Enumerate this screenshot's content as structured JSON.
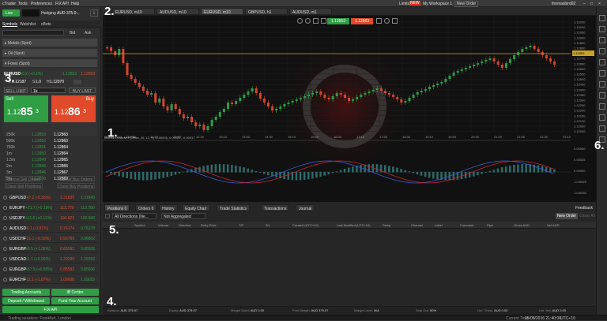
{
  "menu": {
    "app": "cTrader",
    "items": [
      "Tools",
      "Preferences",
      "FIX API",
      "Help"
    ],
    "limits": "Limits",
    "new_badge": "NEW",
    "workspace": "My Workspace 1",
    "new_order": "New Order",
    "user": "thomasbird92"
  },
  "account": {
    "live": "Live",
    "hedging": "Hedging",
    "balance": "AUD 375.0..."
  },
  "left_tabs": [
    "Symbols",
    "Watchlist",
    "cBots"
  ],
  "bidask": {
    "bid": "Bid",
    "ask": "Ask"
  },
  "groups": [
    "Metals (Spot)",
    "Oil (Spot)",
    "Forex (Spot)"
  ],
  "eurusd": {
    "symbol": "EURUSD",
    "change": "+0.2 (+0.1%)",
    "bid": "1.12853",
    "ask": "1.12863",
    "low_label": "L",
    "low": "1.12187",
    "spread_label": "S",
    "spread": "1.0",
    "high_label": "H",
    "high": "1.12970",
    "sell_limit": "SELL LIMIT",
    "buy_limit": "BUY LIMIT",
    "volume": "1k"
  },
  "trade": {
    "sell": "Sell",
    "buy": "Buy",
    "sell_main": "1.12",
    "sell_big": "85",
    "sell_pip": "3",
    "buy_main": "1.12",
    "buy_big": "86",
    "buy_pip": "3"
  },
  "ladder": [
    {
      "vol": "250k",
      "bid": "1.12853",
      "ask": "1.12863"
    },
    {
      "vol": "500k",
      "bid": "1.12852",
      "ask": "1.12863"
    },
    {
      "vol": "750k",
      "bid": "1.12851",
      "ask": "1.12864"
    },
    {
      "vol": "1m",
      "bid": "1.12850",
      "ask": "1.12864"
    },
    {
      "vol": "1.5m",
      "bid": "1.12849",
      "ask": "1.12865"
    },
    {
      "vol": "2m",
      "bid": "1.12848",
      "ask": "1.12866"
    },
    {
      "vol": "3m",
      "bid": "1.12846",
      "ask": "1.12867"
    },
    {
      "vol": "5m",
      "bid": "1.12843",
      "ask": "1.12869"
    }
  ],
  "ladder_buttons": [
    "Cancel Sell Orders",
    "Cancel Buy Orders",
    "Close Sell Positions",
    "Close Buy Positions"
  ],
  "watch": [
    {
      "sym": "GBPUSD",
      "chg": "-47.2 (-0.36%)",
      "bid": "1.31839",
      "ask": "1.31849"
    },
    {
      "sym": "EURJPY",
      "chg": "+21.7 (+0.19%)",
      "bid": "113.770",
      "ask": "113.780"
    },
    {
      "sym": "USDJPY",
      "chg": "+11.6 (+0.11%)",
      "bid": "100.823",
      "ask": "100.840"
    },
    {
      "sym": "AUDUSD",
      "chg": "-6.1 (-0.81%)",
      "bid": "0.76174",
      "ask": "0.76178"
    },
    {
      "sym": "USDCHF",
      "chg": "-31.1 (-0.32%)",
      "bid": "0.96789",
      "ask": "0.96802"
    },
    {
      "sym": "EURGBP",
      "chg": "+8.5 (+1.08%)",
      "bid": "0.85592",
      "ask": "0.85608"
    },
    {
      "sym": "USDCAD",
      "chg": "+1.1 (+0.09%)",
      "bid": "1.29339",
      "ask": "1.29352"
    },
    {
      "sym": "EURGBP",
      "chg": "+67.5 (+0.80%)",
      "bid": "0.85593",
      "ask": "0.85606"
    },
    {
      "sym": "EURCHF",
      "chg": "-11.1 (-1.07%)",
      "bid": "1.09008",
      "ask": "1.09025"
    }
  ],
  "footer_buttons": {
    "trading_accounts": "Trading Accounts",
    "ib_centre": "IB Centre",
    "deposit": "Deposit / Withdrawal",
    "fund": "Fund Your Account",
    "fix_api": "FIX API"
  },
  "chart_tabs": [
    "EURUSD, m10",
    "AUDUSD, m10",
    "EURUSD, m10",
    "GBPUSD, h1",
    "AUDUSD, m1"
  ],
  "chart_prices": {
    "sell": "1.12853",
    "buy": "1.12863",
    "last": "1.12853"
  },
  "y_ticks": [
    "1.12000",
    "1.12050",
    "1.12100",
    "1.12150",
    "1.12200",
    "1.12250",
    "1.12300",
    "1.12350",
    "1.12400",
    "1.12450",
    "1.12500",
    "1.12550",
    "1.12600",
    "1.12650",
    "1.12700",
    "1.12750",
    "1.12800",
    "1.12850",
    "1.12900",
    "1.12950",
    "1.13000",
    "1.13050"
  ],
  "x_ticks": [
    "25 Aug 2016, UTC+10",
    "10:30",
    "11:10",
    "11:50",
    "12:30",
    "13:10",
    "13:50",
    "14:30",
    "15:10",
    "15:50",
    "16:30",
    "17:10",
    "17:50",
    "18:30",
    "19:10",
    "19:50",
    "20:30",
    "21:10",
    "21:50",
    "22:30",
    "23:10"
  ],
  "macd_title": "MACD Crossover (Close, 26, 12, 9) -0.00005, 0.00022, -0.00017",
  "macd_ticks": [
    "0.00050",
    "0.00025",
    "0.00000",
    "-0.00025",
    "-0.00050"
  ],
  "bottom_tabs": [
    {
      "label": "Positions",
      "count": "0"
    },
    {
      "label": "Orders",
      "count": "0"
    },
    {
      "label": "History"
    },
    {
      "label": "Equity Chart"
    },
    {
      "label": "Trade Statistics"
    },
    {
      "label": "Transactions"
    },
    {
      "label": "Journal"
    }
  ],
  "feedback": "Feedback",
  "filters": {
    "direction": "All Directions (Ne...",
    "aggregation": "Not Aggregated"
  },
  "bottom_actions": {
    "new_order": "New Order",
    "close_all": "Close All"
  },
  "columns": [
    "Symbol",
    "Volume",
    "Direction",
    "Entry Price",
    "T/P",
    "S/L",
    "Created (UTC+10)",
    "Last Modified (UTC+10)",
    "Swap",
    "Channel",
    "Label",
    "Comment",
    "Pips",
    "Gross AUD",
    "Net AUD"
  ],
  "account_stats": [
    {
      "k": "Balance",
      "v": "AUD 375.07"
    },
    {
      "k": "Equity",
      "v": "AUD 375.07"
    },
    {
      "k": "Margin Used",
      "v": "AUD 0.00"
    },
    {
      "k": "Free Margin",
      "v": "AUD 375.07"
    },
    {
      "k": "Margin Level",
      "v": "N/A"
    },
    {
      "k": "Stop Out",
      "v": "50%"
    },
    {
      "k": "Unr. Gross",
      "v": "AUD 0.00"
    },
    {
      "k": "Unr. Net",
      "v": "AUD 0.00"
    }
  ],
  "status": {
    "left": "Trading sessions: Frankfurt, London",
    "time_label": "Current Time",
    "time": "25/08/2016 21:40:06",
    "tz": "UTC+10"
  },
  "overlay_labels": [
    "1.",
    "2.",
    "3.",
    "4.",
    "5.",
    "6."
  ],
  "colors": {
    "bull": "#2e9b48",
    "bear": "#d6452b",
    "accent": "#2f9e44",
    "sell": "#2f9e44",
    "buy": "#e04a2a"
  }
}
